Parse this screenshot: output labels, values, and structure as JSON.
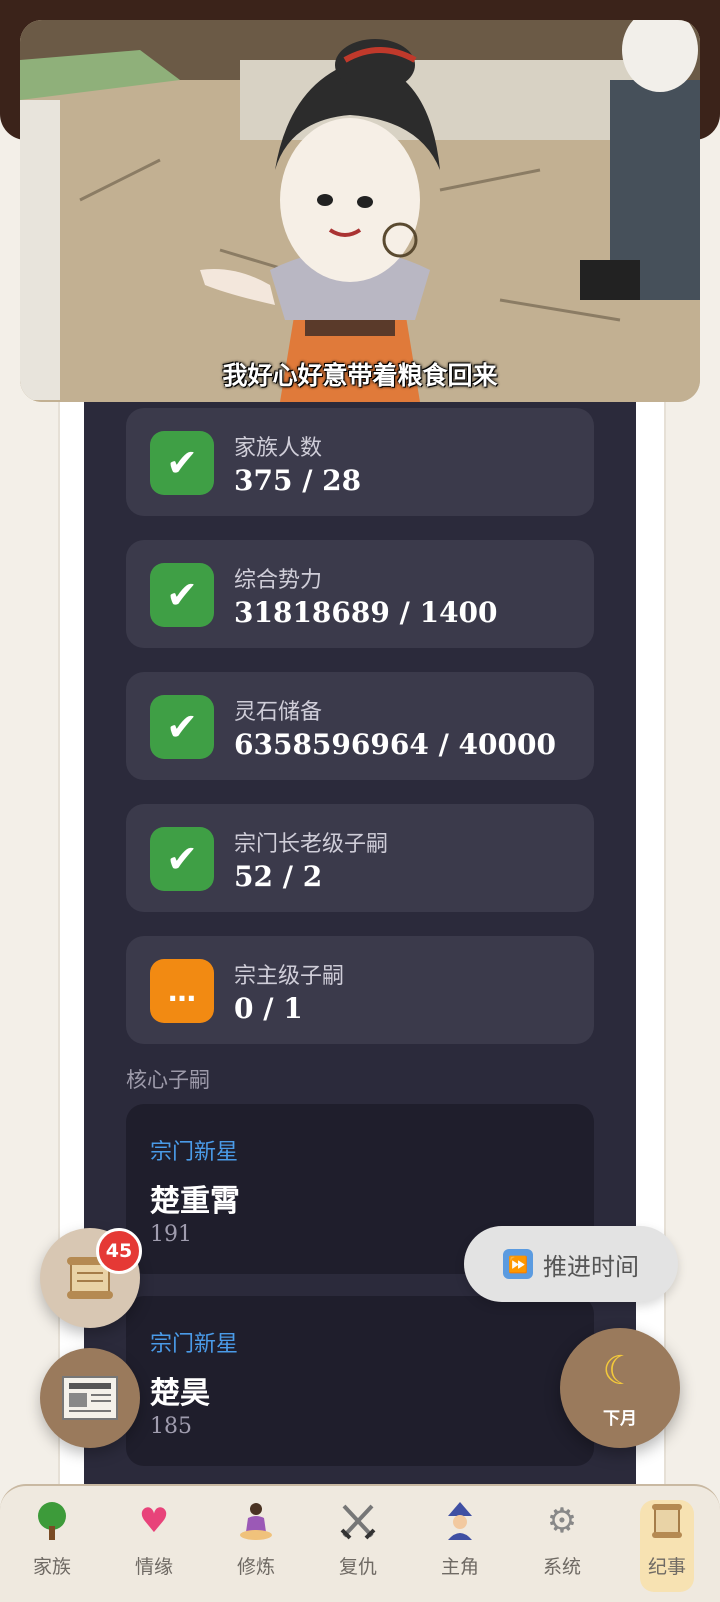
{
  "video": {
    "subtitle": "我好心好意带着粮食回来"
  },
  "requirements": [
    {
      "label": "家族人数",
      "value": "375 / 28",
      "status": "done"
    },
    {
      "label": "综合势力",
      "value": "31818689 / 1400",
      "status": "done"
    },
    {
      "label": "灵石储备",
      "value": "6358596964 / 40000",
      "status": "done"
    },
    {
      "label": "宗门长老级子嗣",
      "value": "52 / 2",
      "status": "done"
    },
    {
      "label": "宗主级子嗣",
      "value": "0 / 1",
      "status": "pending"
    }
  ],
  "icons": {
    "done": "✔",
    "pending": "…"
  },
  "core_heirs": {
    "label": "核心子嗣",
    "items": [
      {
        "title": "宗门新星",
        "name": "楚重霄",
        "value": "191"
      },
      {
        "title": "宗门新星",
        "name": "楚昊",
        "value": "185"
      }
    ]
  },
  "floating": {
    "scroll_badge": "45",
    "advance_time": "推进时间",
    "next_month": "下月"
  },
  "tabs": [
    {
      "label": "家族",
      "icon": "tree-icon"
    },
    {
      "label": "情缘",
      "icon": "hearts-icon"
    },
    {
      "label": "修炼",
      "icon": "meditation-icon"
    },
    {
      "label": "复仇",
      "icon": "crossed-swords-icon"
    },
    {
      "label": "主角",
      "icon": "mage-icon"
    },
    {
      "label": "系统",
      "icon": "gear-icon"
    },
    {
      "label": "纪事",
      "icon": "scroll-icon",
      "active": true
    }
  ],
  "colors": {
    "panel": "#2b2a3b",
    "done": "#3f9f45",
    "pending": "#f28a12",
    "accent_blue": "#4a9be8"
  }
}
